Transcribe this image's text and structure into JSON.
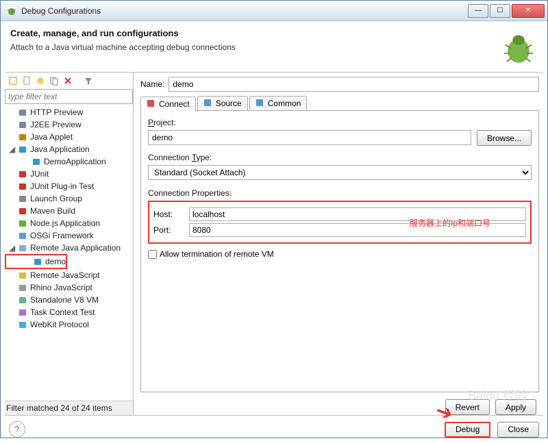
{
  "window": {
    "title": "Debug Configurations",
    "header_title": "Create, manage, and run configurations",
    "header_sub": "Attach to a Java virtual machine accepting debug connections"
  },
  "left": {
    "filter_placeholder": "type filter text",
    "items": [
      {
        "label": "HTTP Preview",
        "depth": 1,
        "icon": "server"
      },
      {
        "label": "J2EE Preview",
        "depth": 1,
        "icon": "server"
      },
      {
        "label": "Java Applet",
        "depth": 1,
        "icon": "applet"
      },
      {
        "label": "Java Application",
        "depth": 1,
        "icon": "java",
        "expanded": true
      },
      {
        "label": "DemoApplication",
        "depth": 2,
        "icon": "java"
      },
      {
        "label": "JUnit",
        "depth": 1,
        "icon": "junit"
      },
      {
        "label": "JUnit Plug-in Test",
        "depth": 1,
        "icon": "junit"
      },
      {
        "label": "Launch Group",
        "depth": 1,
        "icon": "group"
      },
      {
        "label": "Maven Build",
        "depth": 1,
        "icon": "maven"
      },
      {
        "label": "Node.js Application",
        "depth": 1,
        "icon": "node"
      },
      {
        "label": "OSGi Framework",
        "depth": 1,
        "icon": "osgi"
      },
      {
        "label": "Remote Java Application",
        "depth": 1,
        "icon": "remote",
        "expanded": true
      },
      {
        "label": "demo",
        "depth": 2,
        "icon": "java",
        "selected": true,
        "highlight": true
      },
      {
        "label": "Remote JavaScript",
        "depth": 1,
        "icon": "js"
      },
      {
        "label": "Rhino JavaScript",
        "depth": 1,
        "icon": "rhino"
      },
      {
        "label": "Standalone V8 VM",
        "depth": 1,
        "icon": "v8"
      },
      {
        "label": "Task Context Test",
        "depth": 1,
        "icon": "task"
      },
      {
        "label": "WebKit Protocol",
        "depth": 1,
        "icon": "webkit"
      }
    ],
    "filter_status": "Filter matched 24 of 24 items"
  },
  "right": {
    "name_label": "Name:",
    "name_value": "demo",
    "tabs": [
      {
        "label": "Connect",
        "icon": "connect",
        "active": true
      },
      {
        "label": "Source",
        "icon": "source"
      },
      {
        "label": "Common",
        "icon": "common"
      }
    ],
    "project_label": "Project:",
    "project_value": "demo",
    "browse_label": "Browse...",
    "conn_type_label": "Connection Type:",
    "conn_type_value": "Standard (Socket Attach)",
    "conn_props_label": "Connection Properties:",
    "host_label": "Host:",
    "host_value": "localhost",
    "port_label": "Port:",
    "port_value": "8080",
    "annotation": "服务器上的Ip和端口号",
    "allow_term_label": "Allow termination of remote VM",
    "revert_label": "Revert",
    "apply_label": "Apply"
  },
  "footer": {
    "debug_label": "Debug",
    "close_label": "Close"
  },
  "watermark": "Baidu 经验"
}
